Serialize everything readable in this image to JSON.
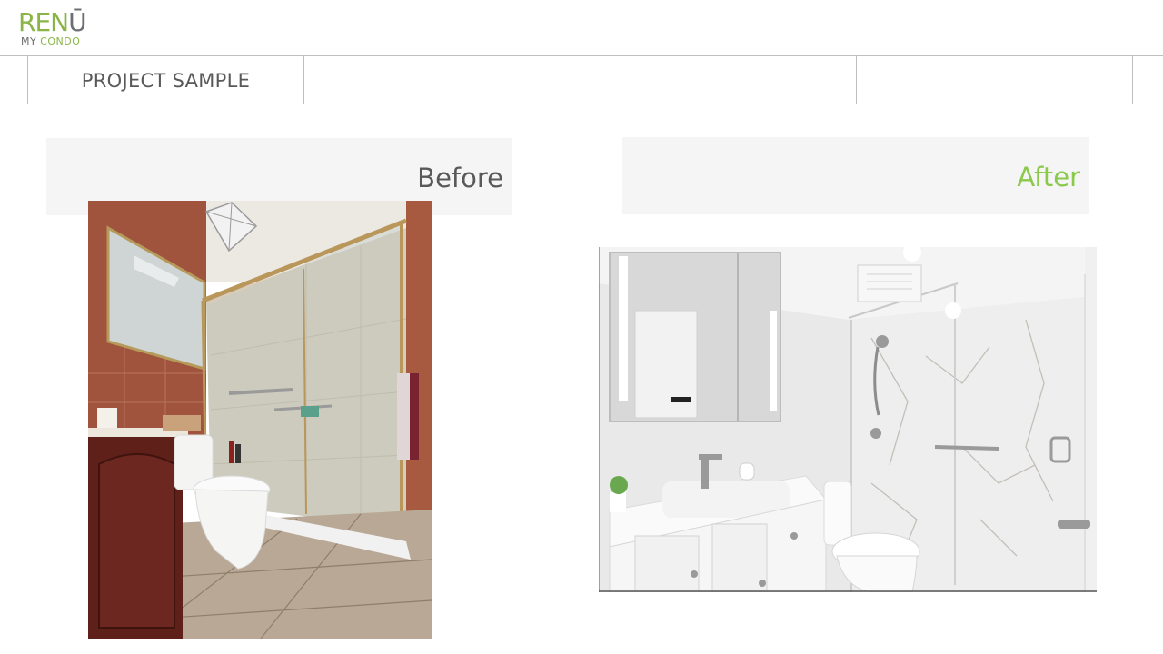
{
  "logo": {
    "main_re": "REN",
    "main_u": "Ū",
    "sub_my": "MY",
    "sub_condo": "CONDO"
  },
  "header": {
    "title": "PROJECT SAMPLE"
  },
  "labels": {
    "before": "Before",
    "after": "After"
  },
  "colors": {
    "brand_green": "#8ab446",
    "after_green": "#8ac94a",
    "text_gray": "#595959",
    "label_bg": "#f5f5f5",
    "rule": "#bfbfbf"
  }
}
